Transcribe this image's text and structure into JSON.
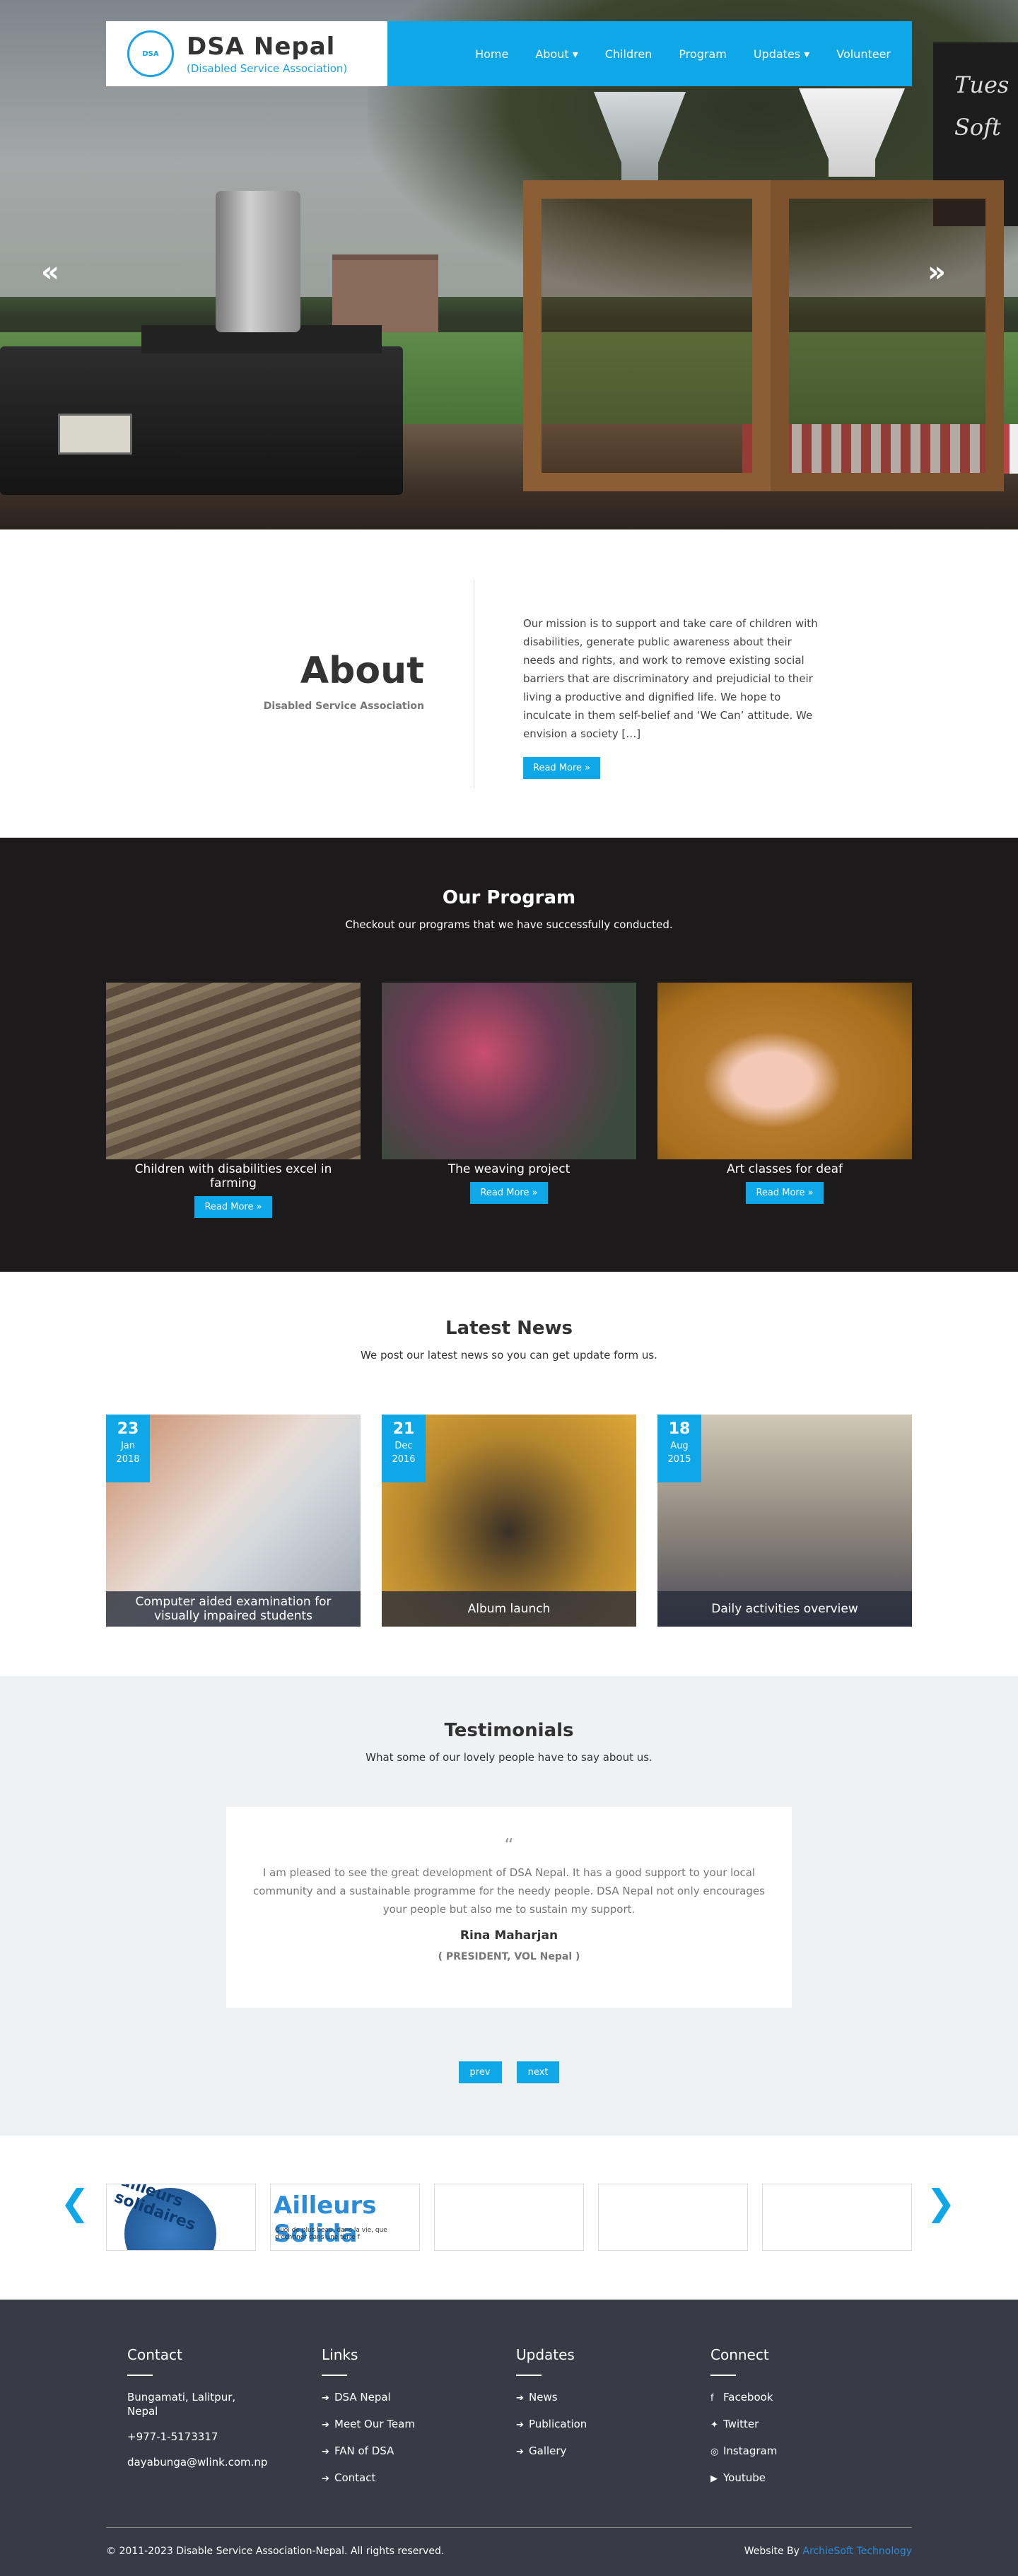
{
  "brand": {
    "title": "DSA Nepal",
    "subtitle": "(Disabled Service Association)",
    "logo_text": "DSA"
  },
  "nav": [
    "Home",
    "About ▾",
    "Children",
    "Program",
    "Updates ▾",
    "Volunteer"
  ],
  "hero": {
    "board_text": "Tues Soft",
    "prev": "«",
    "next": "»"
  },
  "about": {
    "title": "About",
    "subtitle": "Disabled Service Association",
    "text": "Our mission is to support and take care of children with disabilities, generate public awareness about their needs and rights, and work to remove existing social barriers that are discriminatory and prejudicial to their living a productive and dignified life. We hope to inculcate in them self-belief and ‘We Can’ attitude. We envision a society […]",
    "button": "Read More »"
  },
  "program": {
    "title": "Our Program",
    "subtitle": "Checkout our programs that we have successfully conducted.",
    "items": [
      {
        "caption": "Children with disabilities excel in farming",
        "button": "Read More »"
      },
      {
        "caption": "The weaving project",
        "button": "Read More »"
      },
      {
        "caption": "Art classes for deaf",
        "button": "Read More »"
      }
    ]
  },
  "news": {
    "title": "Latest News",
    "subtitle": "We post our latest news so you can get update form us.",
    "items": [
      {
        "day": "23",
        "month": "Jan",
        "year": "2018",
        "caption": "Computer aided examination for visually impaired students"
      },
      {
        "day": "21",
        "month": "Dec",
        "year": "2016",
        "caption": "Album launch"
      },
      {
        "day": "18",
        "month": "Aug",
        "year": "2015",
        "caption": "Daily activities overview"
      }
    ]
  },
  "testimonials": {
    "title": "Testimonials",
    "subtitle": "What some of our lovely people have to say about us.",
    "quote_mark": "“",
    "text": "I am pleased to see the great development of DSA Nepal. It has a good support to your local community and a sustainable programme for the needy people. DSA Nepal not only encourages your people but also me to sustain my support.",
    "name": "Rina Maharjan",
    "role": "( PRESIDENT, VOL Nepal )",
    "prev": "prev",
    "next": "next"
  },
  "partners": {
    "prev": "❮",
    "next": "❯",
    "logos": [
      "ailleurs solidaires",
      "Ailleurs Solida",
      "Quoi de plus beau, dans la vie, que d'échnner dans une terre f"
    ]
  },
  "footer": {
    "contact": {
      "title": "Contact",
      "address": "Bungamati, Lalitpur, Nepal",
      "phone": "+977-1-5173317",
      "email": "dayabunga@wlink.com.np"
    },
    "links": {
      "title": "Links",
      "items": [
        "DSA Nepal",
        "Meet Our Team",
        "FAN of DSA",
        "Contact"
      ]
    },
    "updates": {
      "title": "Updates",
      "items": [
        "News",
        "Publication",
        "Gallery"
      ]
    },
    "connect": {
      "title": "Connect",
      "items": [
        "Facebook",
        "Twitter",
        "Instagram",
        "Youtube"
      ]
    },
    "copyright": "© 2011-2023 Disable Service Association-Nepal. All rights reserved.",
    "by_prefix": "Website By",
    "by_link": "ArchieSoft Technology"
  },
  "colors": {
    "accent": "#0ea8e8",
    "footer_bg": "#383a46",
    "program_bg": "#1c1a1a",
    "testimonial_bg": "#f0f1f3"
  }
}
